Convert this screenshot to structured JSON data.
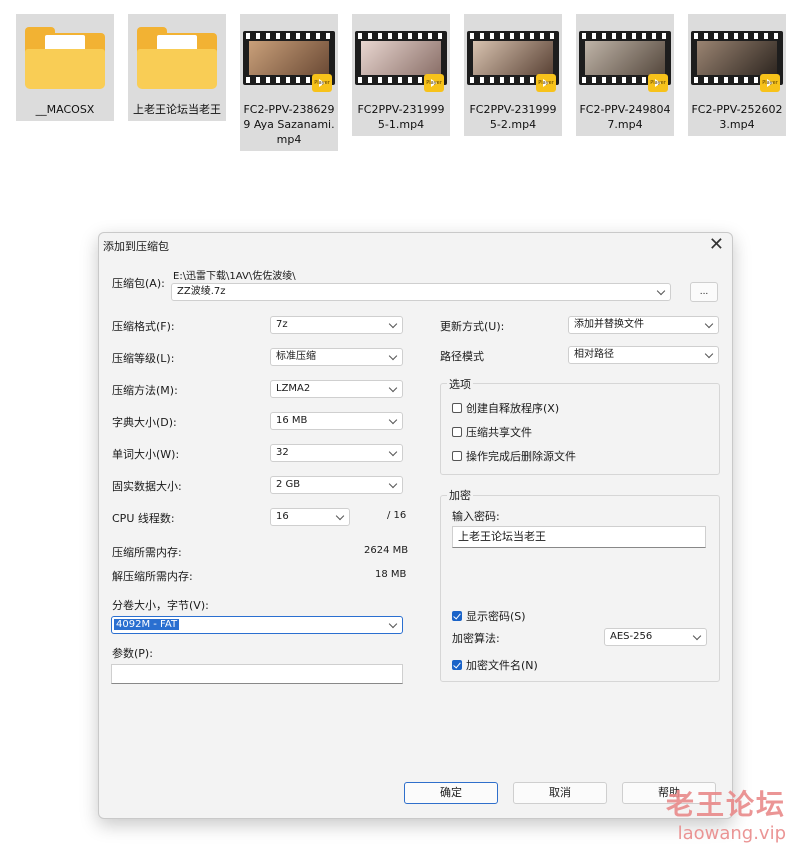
{
  "files": [
    {
      "name": "__MACOSX",
      "kind": "folder"
    },
    {
      "name": "上老王论坛当老王",
      "kind": "folder"
    },
    {
      "name": "FC2-PPV-2386299 Aya Sazanami.mp4",
      "kind": "video"
    },
    {
      "name": "FC2PPV-2319995-1.mp4",
      "kind": "video"
    },
    {
      "name": "FC2PPV-2319995-2.mp4",
      "kind": "video"
    },
    {
      "name": "FC2-PPV-2498047.mp4",
      "kind": "video"
    },
    {
      "name": "FC2-PPV-2526023.mp4",
      "kind": "video"
    }
  ],
  "badge_label": "Player",
  "dialog": {
    "title": "添加到压缩包",
    "archive_label": "压缩包(A):",
    "archive_path": "E:\\迅雷下载\\1AV\\佐佐波绫\\",
    "archive_name": "ZZ波绫.7z",
    "browse_label": "...",
    "left": [
      {
        "label": "压缩格式(F):",
        "value": "7z"
      },
      {
        "label": "压缩等级(L):",
        "value": "标准压缩"
      },
      {
        "label": "压缩方法(M):",
        "value": "LZMA2"
      },
      {
        "label": "字典大小(D):",
        "value": "16 MB"
      },
      {
        "label": "单词大小(W):",
        "value": "32"
      },
      {
        "label": "固实数据大小:",
        "value": "2 GB"
      }
    ],
    "cpu": {
      "label": "CPU 线程数:",
      "value": "16",
      "total": "/ 16"
    },
    "mem_compress": {
      "label": "压缩所需内存:",
      "value": "2624 MB"
    },
    "mem_decompress": {
      "label": "解压缩所需内存:",
      "value": "18 MB"
    },
    "volume": {
      "label": "分卷大小，字节(V):",
      "value": "4092M - FAT"
    },
    "params_label": "参数(P):",
    "update": {
      "label": "更新方式(U):",
      "value": "添加并替换文件"
    },
    "path_mode": {
      "label": "路径模式",
      "value": "相对路径"
    },
    "options": {
      "title": "选项",
      "items": [
        {
          "label": "创建自释放程序(X)",
          "checked": false
        },
        {
          "label": "压缩共享文件",
          "checked": false
        },
        {
          "label": "操作完成后删除源文件",
          "checked": false
        }
      ]
    },
    "encryption": {
      "title": "加密",
      "password_label": "输入密码:",
      "password": "上老王论坛当老王",
      "show_password": "显示密码(S)",
      "method_label": "加密算法:",
      "method": "AES-256",
      "encrypt_names": "加密文件名(N)"
    },
    "buttons": {
      "ok": "确定",
      "cancel": "取消",
      "help": "帮助"
    }
  },
  "watermark": {
    "line1": "老王论坛",
    "line2": "laowang.vip"
  }
}
